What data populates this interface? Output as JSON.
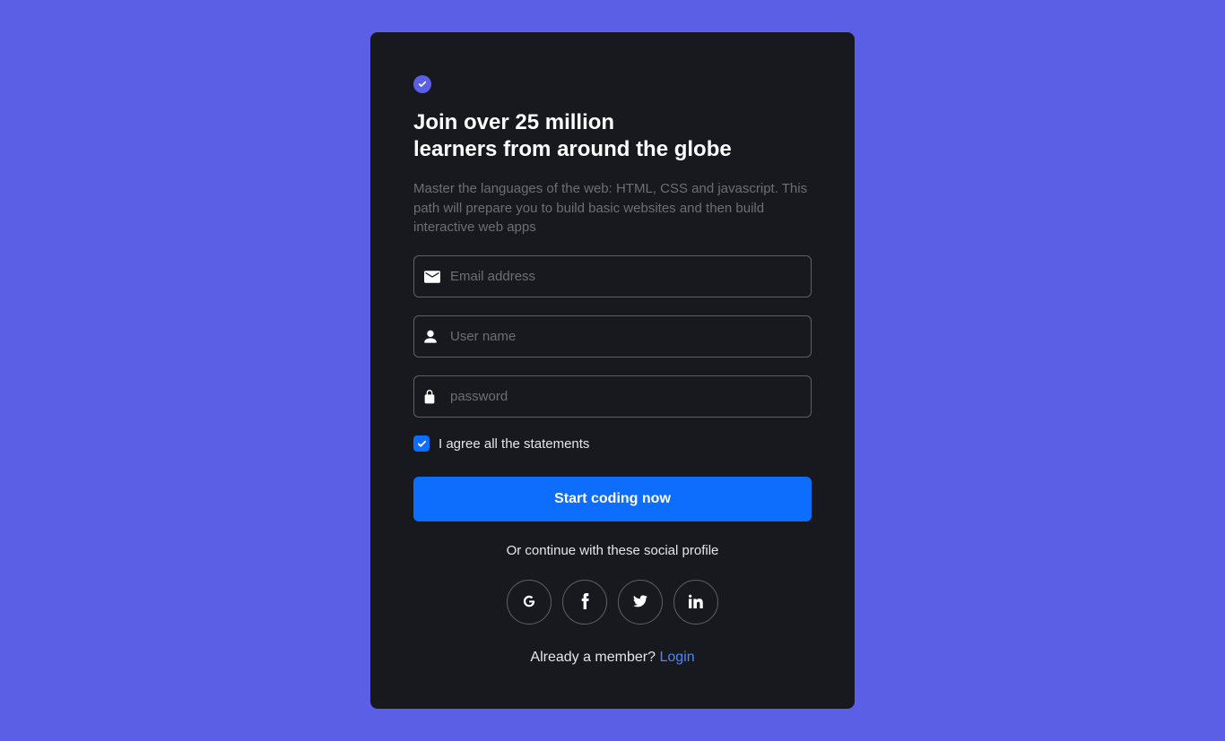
{
  "heading_line1": "Join over 25 million",
  "heading_line2": "learners from around the globe",
  "subtitle": "Master the languages of the web: HTML, CSS and javascript. This path will prepare you to build basic websites and then build interactive web apps",
  "form": {
    "email": {
      "placeholder": "Email address",
      "value": ""
    },
    "username": {
      "placeholder": "User name",
      "value": ""
    },
    "password": {
      "placeholder": "password",
      "value": ""
    },
    "agree_label": "I agree all the statements",
    "agree_checked": true,
    "submit_label": "Start coding now"
  },
  "social": {
    "continue_label": "Or continue with these social profile",
    "providers": [
      "google",
      "facebook",
      "twitter",
      "linkedin"
    ]
  },
  "login": {
    "prefix": "Already a member? ",
    "link_text": "Login"
  },
  "colors": {
    "page_bg": "#5a5fe6",
    "card_bg": "#18191f",
    "primary": "#0d6efd",
    "accent_link": "#4f86f7"
  }
}
